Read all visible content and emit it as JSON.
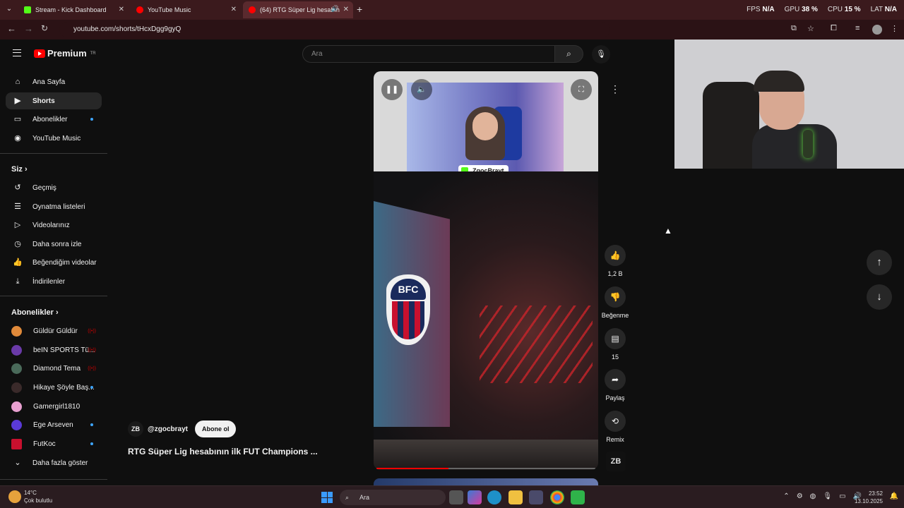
{
  "browser": {
    "tabs": [
      {
        "label": "Stream - Kick Dashboard",
        "favicon_color": "#53fc18"
      },
      {
        "label": "YouTube Music",
        "favicon_color": "#ff0000"
      },
      {
        "label": "(64) RTG Süper Lig hesabın",
        "favicon_color": "#ff0000"
      }
    ],
    "url": "youtube.com/shorts/tHcxDgg9gyQ",
    "overlay_stats": {
      "fps_label": "FPS",
      "fps_value": "N/A",
      "gpu_label": "GPU",
      "gpu_value": "38 %",
      "cpu_label": "CPU",
      "cpu_value": "15 %",
      "lat_label": "LAT",
      "lat_value": "N/A"
    }
  },
  "youtube": {
    "logo_text": "Premium",
    "logo_region": "TR",
    "search_placeholder": "Ara",
    "sidebar": {
      "main": [
        {
          "label": "Ana Sayfa",
          "icon": "home-icon"
        },
        {
          "label": "Shorts",
          "icon": "shorts-icon"
        },
        {
          "label": "Abonelikler",
          "icon": "subscriptions-icon"
        },
        {
          "label": "YouTube Music",
          "icon": "music-icon"
        }
      ],
      "you_header": "Siz",
      "you": [
        {
          "label": "Geçmiş",
          "icon": "history-icon"
        },
        {
          "label": "Oynatma listeleri",
          "icon": "playlist-icon"
        },
        {
          "label": "Videolarınız",
          "icon": "your-videos-icon"
        },
        {
          "label": "Daha sonra izle",
          "icon": "watch-later-icon"
        },
        {
          "label": "Beğendiğim videolar",
          "icon": "liked-icon"
        },
        {
          "label": "İndirilenler",
          "icon": "download-icon"
        }
      ],
      "subs_header": "Abonelikler",
      "subscriptions": [
        {
          "label": "Güldür Güldür",
          "color": "#e08a3a",
          "indicator": "live"
        },
        {
          "label": "beIN SPORTS Tü...",
          "color": "#6a3aa8",
          "indicator": "live"
        },
        {
          "label": "Diamond Tema",
          "color": "#4a6a5a",
          "indicator": "live"
        },
        {
          "label": "Hikaye Şöyle Baş...",
          "color": "#3a2a2a",
          "indicator": "dot"
        },
        {
          "label": "Gamergirl1810",
          "color": "#e8a0d0",
          "indicator": "none"
        },
        {
          "label": "Ege Arseven",
          "color": "#5a3ad8",
          "indicator": "dot"
        },
        {
          "label": "FutKoc",
          "color": "#c8102e",
          "indicator": "dot"
        }
      ],
      "show_more": "Daha fazla göster"
    },
    "short": {
      "streamer_tag": "ZgocBrayt",
      "channel_handle": "@zgocbrayt",
      "channel_avatar": "ZB",
      "subscribe_label": "Abone ol",
      "title": "RTG Süper Lig hesabının ilk FUT Champions ...",
      "crest_text": "BFC",
      "progress": 0.33
    },
    "actions": {
      "like_count": "1,2 B",
      "dislike_label": "Beğenme",
      "comment_count": "15",
      "share_label": "Paylaş",
      "remix_label": "Remix"
    }
  },
  "taskbar": {
    "weather_temp": "14°C",
    "weather_desc": "Çok bulutlu",
    "search_label": "Ara",
    "time": "23:52",
    "date": "13.10.2025"
  }
}
